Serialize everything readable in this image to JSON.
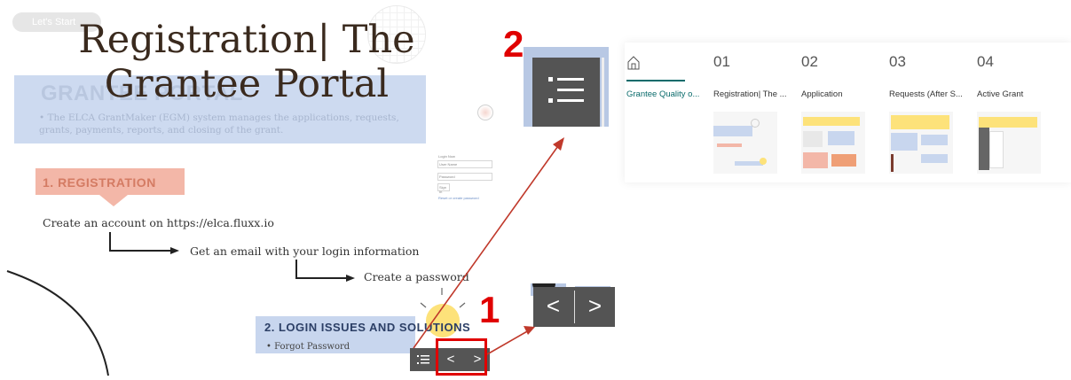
{
  "slide": {
    "lets_start": "Let's Start",
    "title_line1": "Registration| The",
    "title_line2": "Grantee Portal",
    "grantee_heading": "GRANTEE PORTAL",
    "grantee_bullet": "• The ELCA GrantMaker (EGM) system manages the applications, requests, grants, payments, reports, and closing of the grant.",
    "registration_heading": "1. REGISTRATION",
    "step1": "Create an account on https://elca.fluxx.io",
    "step2": "Get an email with your login information",
    "step3": "Create a password",
    "login_heading": "2. LOGIN ISSUES AND SOLUTIONS",
    "forgot_password": "• Forgot Password",
    "login_form": {
      "title": "Login Now",
      "username": "User Name",
      "password": "Password",
      "sign_in": "Sign In",
      "reset": "Reset or create password"
    }
  },
  "toolbar": {
    "outline_icon": "outline-list-icon",
    "prev": "<",
    "next": ">"
  },
  "callouts": {
    "one": "1",
    "two": "2"
  },
  "zoom_nav": {
    "prev": "<",
    "next": ">"
  },
  "outline": {
    "home_label": "Grantee Quality o...",
    "sections": [
      {
        "num": "01",
        "label": "Registration| The ..."
      },
      {
        "num": "02",
        "label": "Application"
      },
      {
        "num": "03",
        "label": "Requests (After S..."
      },
      {
        "num": "04",
        "label": "Active Grant"
      }
    ]
  },
  "colors": {
    "accent": "#0a6b6b",
    "callout": "#e00000",
    "toolbar": "#545454"
  }
}
